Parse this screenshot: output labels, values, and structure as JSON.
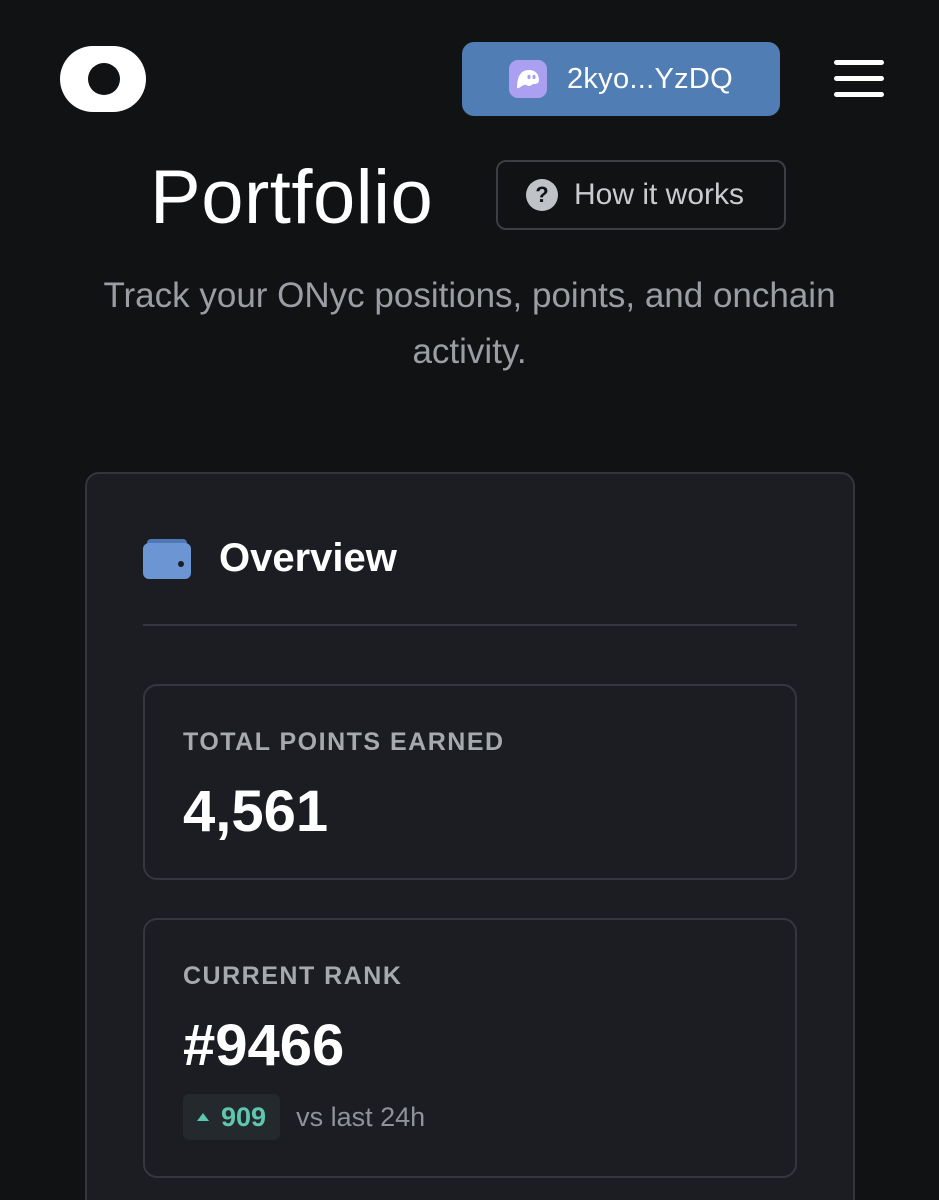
{
  "header": {
    "wallet_address": "2kyo...YzDQ",
    "wallet_icon": "phantom-ghost-icon",
    "menu_icon": "hamburger-menu-icon",
    "logo_icon": "app-logo-icon"
  },
  "page": {
    "title": "Portfolio",
    "how_it_works_label": "How it works",
    "subtitle": "Track your ONyc positions, points, and onchain activity."
  },
  "overview": {
    "title": "Overview",
    "icon": "wallet-icon",
    "total_points": {
      "label": "TOTAL POINTS EARNED",
      "value": "4,561"
    },
    "current_rank": {
      "label": "CURRENT RANK",
      "value": "#9466",
      "change": "909",
      "change_direction": "up",
      "change_suffix": "vs last 24h"
    }
  },
  "colors": {
    "background": "#111214",
    "card": "#1b1d22",
    "accent_blue": "#4f7db4",
    "positive": "#5fc7b0"
  }
}
